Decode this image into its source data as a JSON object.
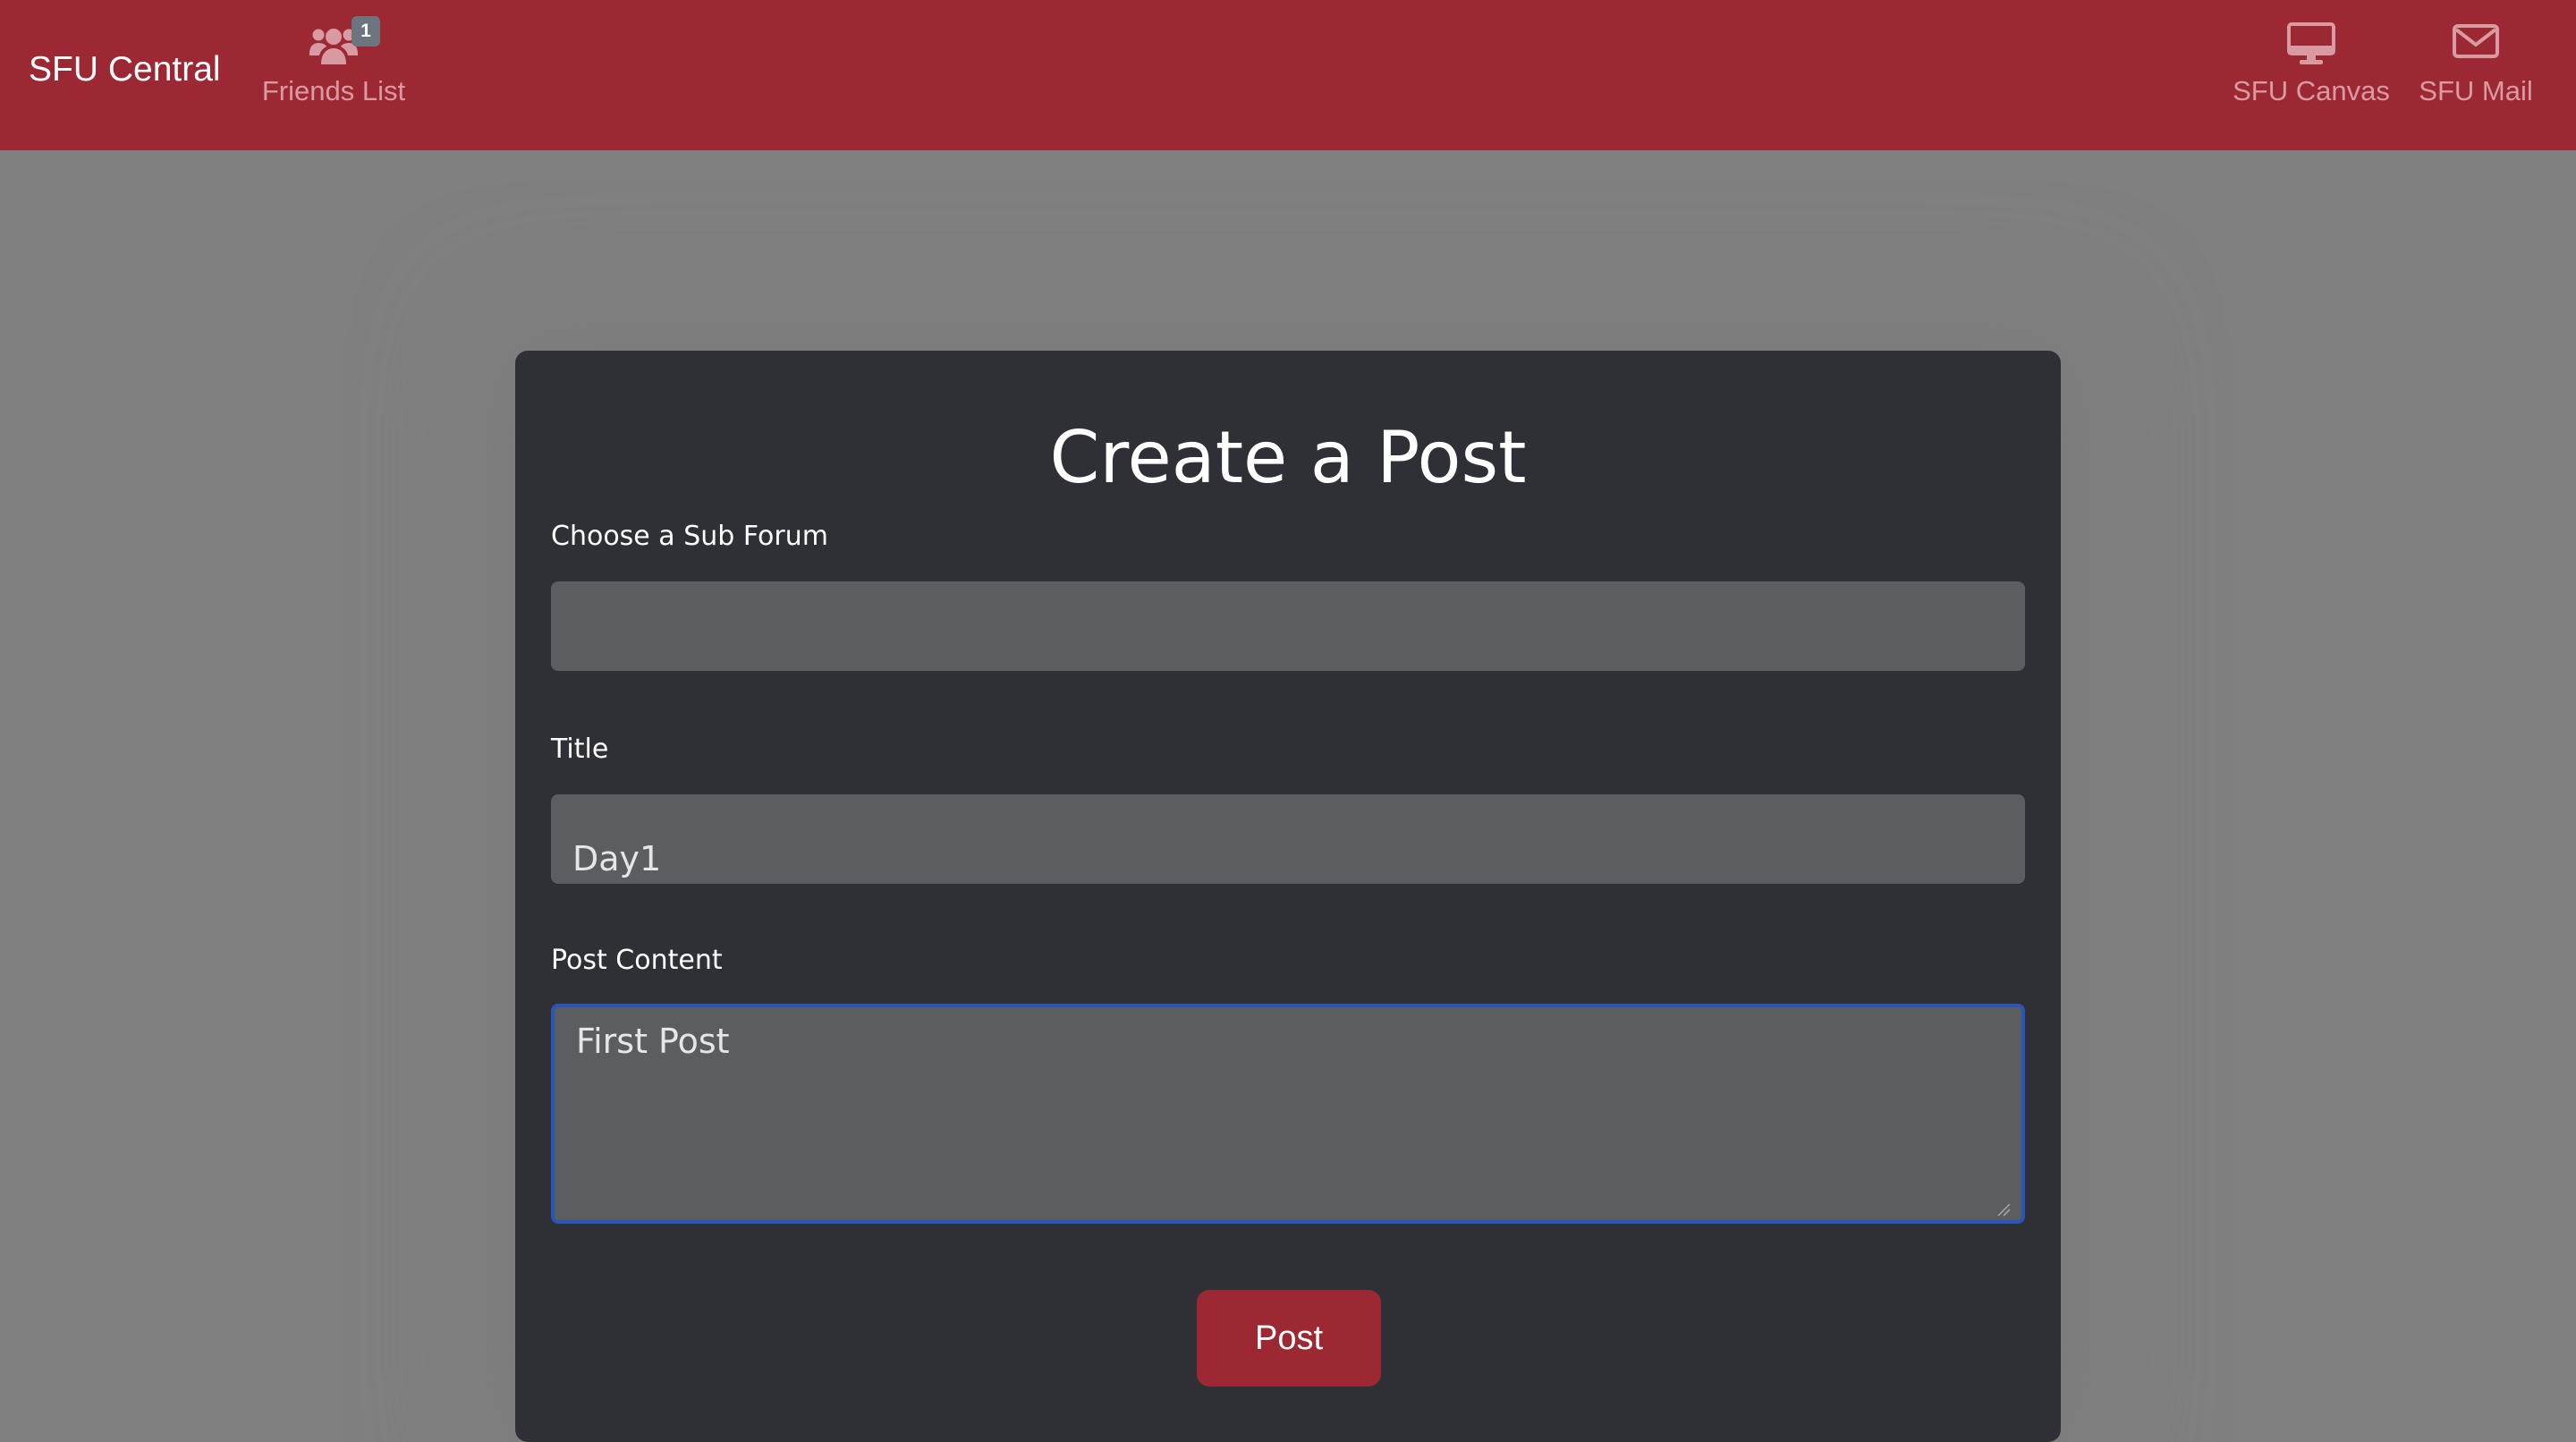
{
  "navbar": {
    "brand": "SFU Central",
    "friends": {
      "label": "Friends List",
      "badge_count": "1",
      "icon": "users-icon"
    },
    "canvas": {
      "label": "SFU Canvas",
      "icon": "desktop-icon"
    },
    "mail": {
      "label": "SFU Mail",
      "icon": "envelope-icon"
    }
  },
  "form": {
    "heading": "Create a Post",
    "subforum": {
      "label": "Choose a Sub Forum",
      "value": ""
    },
    "title": {
      "label": "Title",
      "value": "Day1"
    },
    "content": {
      "label": "Post Content",
      "value": "First Post"
    },
    "submit_label": "Post"
  },
  "colors": {
    "brand_red": "#9c2834",
    "nav_link": "#d99aa1",
    "page_background": "#808080",
    "card_background": "#2f3035",
    "input_background": "#5a5e60",
    "focus_border": "#2a55b5",
    "badge": "#6c757d"
  }
}
